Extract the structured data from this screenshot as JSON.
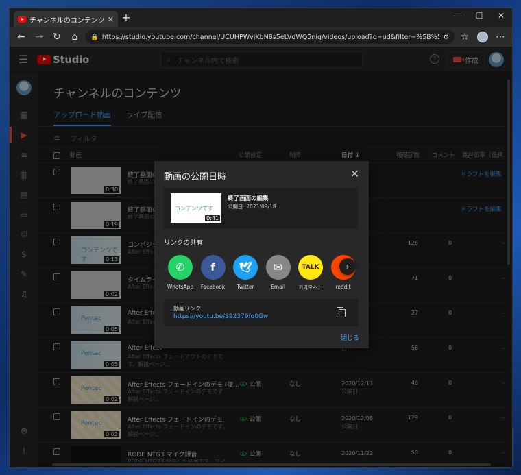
{
  "browser": {
    "tab_title": "チャンネルのコンテンツ - YouTube Stu",
    "url": "https://studio.youtube.com/channel/UCUHPWvjKbN8s5eLVdWQ5nig/videos/upload?d=ud&filter=%5B%5D&sort=%7B\"colu..."
  },
  "header": {
    "logo_text": "Studio",
    "search_placeholder": "チャンネル内で検索",
    "create_label": "作成"
  },
  "page": {
    "title": "チャンネルのコンテンツ",
    "tabs": [
      {
        "label": "アップロード動画"
      },
      {
        "label": "ライブ配信"
      }
    ],
    "filter_label": "フィルタ"
  },
  "table": {
    "headers": {
      "video": "動画",
      "visibility": "公開設定",
      "restrictions": "制限",
      "date": "日付 ↓",
      "views": "視聴回数",
      "comments": "コメント",
      "likes": "高評価率（低評..."
    },
    "rows": [
      {
        "thumb_label": "",
        "duration": "0:30",
        "title": "終了画面の編",
        "desc": "終了画面の編",
        "visibility": "",
        "restriction": "",
        "date": "",
        "date_sub": "",
        "views": "",
        "comments": "",
        "likes": "",
        "draft": "ドラフトを編集"
      },
      {
        "thumb_label": "",
        "duration": "0:19",
        "title": "終了画面の編",
        "desc": "終了画面の編",
        "visibility": "",
        "restriction": "",
        "date": "",
        "date_sub": "",
        "views": "",
        "comments": "",
        "likes": "",
        "draft": "ドラフトを編集"
      },
      {
        "thumb_label": "コンテンツです",
        "duration": "0:13",
        "title": "コンポジシ",
        "desc": "After Effects ジションを作",
        "visibility": "",
        "restriction": "",
        "date": "5",
        "date_sub": "",
        "views": "126",
        "comments": "0",
        "likes": "–",
        "draft": ""
      },
      {
        "thumb_label": "",
        "duration": "0:02",
        "title": "タイムライ",
        "desc": "After Effects 書き出し出",
        "visibility": "",
        "restriction": "",
        "date": "4",
        "date_sub": "",
        "views": "71",
        "comments": "0",
        "likes": "–",
        "draft": ""
      },
      {
        "thumb_label": "Pentec",
        "duration": "0:05",
        "title": "After Effect",
        "desc": "After Effects 解説ページ",
        "visibility": "",
        "restriction": "",
        "date": "3",
        "date_sub": "",
        "views": "27",
        "comments": "0",
        "likes": "–",
        "draft": ""
      },
      {
        "thumb_label": "Pentec",
        "duration": "0:05",
        "title": "After Effect",
        "desc": "After Effects フェードアウトのデモです。解説ページ...",
        "visibility": "",
        "restriction": "",
        "date": "日",
        "date_sub": "",
        "views": "56",
        "comments": "0",
        "likes": "–",
        "draft": ""
      },
      {
        "thumb_label": "Pentec",
        "duration": "0:02",
        "title": "After Effects フェードインのデモ (復...",
        "desc": "After Effects フェードインのデモです 解説ページ...",
        "visibility": "公開",
        "restriction": "なし",
        "date": "2020/12/13",
        "date_sub": "公開日",
        "views": "46",
        "comments": "0",
        "likes": "–",
        "draft": ""
      },
      {
        "thumb_label": "Pentec",
        "duration": "0:02",
        "title": "After Effects フェードインのデモ",
        "desc": "After Effects フェードインのデモです。解説ページ...",
        "visibility": "公開",
        "restriction": "なし",
        "date": "2020/12/08",
        "date_sub": "公開日",
        "views": "129",
        "comments": "0",
        "likes": "–",
        "draft": ""
      },
      {
        "thumb_label": "",
        "duration": "",
        "title": "RODE NTG3 マイク録音",
        "desc": "RODE NTG3を録音した結果です。マイク",
        "visibility": "公開",
        "restriction": "なし",
        "date": "2020/11/23",
        "date_sub": "",
        "views": "50",
        "comments": "0",
        "likes": "–",
        "draft": ""
      }
    ]
  },
  "dialog": {
    "title": "動画の公開日時",
    "video_title": "終了画面の編集",
    "video_date": "公開日: 2021/09/18",
    "video_thumb_label": "コンテンツです",
    "video_duration": "0:41",
    "share_heading": "リンクの共有",
    "share_targets": [
      {
        "label": "WhatsApp",
        "glyph": "✆",
        "color": "#25d366"
      },
      {
        "label": "Facebook",
        "glyph": "f",
        "color": "#3b5998"
      },
      {
        "label": "Twitter",
        "glyph": "🕊",
        "color": "#1da1f2"
      },
      {
        "label": "Email",
        "glyph": "✉",
        "color": "#888888"
      },
      {
        "label": "카카오스...",
        "glyph": "TALK",
        "color": "#ffe812"
      },
      {
        "label": "reddit",
        "glyph": "◕",
        "color": "#ff4500"
      }
    ],
    "link_label": "動画リンク",
    "link_url": "https://youtu.be/S92379fo0Gw",
    "done_label": "閉じる"
  },
  "colors": {
    "accent": "#3ea6ff",
    "brand": "#ff0000",
    "public": "#2ba640"
  }
}
